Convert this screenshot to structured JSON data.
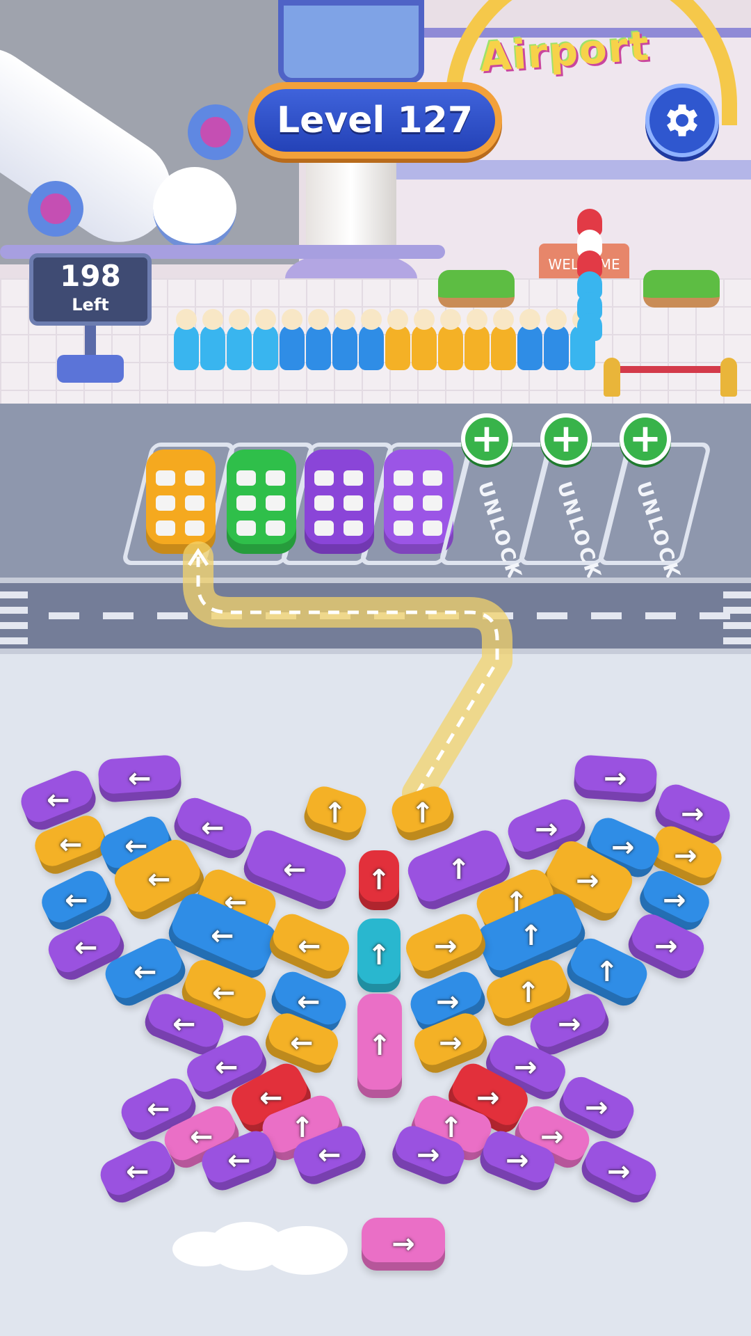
{
  "hud": {
    "level_label": "Level 127",
    "passengers_left_count": "198",
    "passengers_left_label": "Left"
  },
  "scene": {
    "airport_sign": "Airport",
    "welcome_sign": "WELCOME"
  },
  "parking": {
    "unlock_label": "UNLOCK",
    "locked_slot_count": 3,
    "parked_cars": [
      {
        "color": "#f5a91f",
        "name": "yellow"
      },
      {
        "color": "#2fbf4a",
        "name": "green"
      },
      {
        "color": "#8a45d8",
        "name": "purple"
      },
      {
        "color": "#9b55e6",
        "name": "purple"
      }
    ]
  },
  "palette": {
    "purple": "#9a52e0",
    "yellow": "#f4b126",
    "blue": "#2f8de6",
    "red": "#e2303b",
    "cyan": "#29b7cf",
    "pink": "#ea6fc6"
  },
  "icons": {
    "settings": "gear-icon",
    "unlock": "plus-icon",
    "arrow_up": "↑",
    "arrow_down": "↓",
    "arrow_left": "←",
    "arrow_right": "→"
  }
}
